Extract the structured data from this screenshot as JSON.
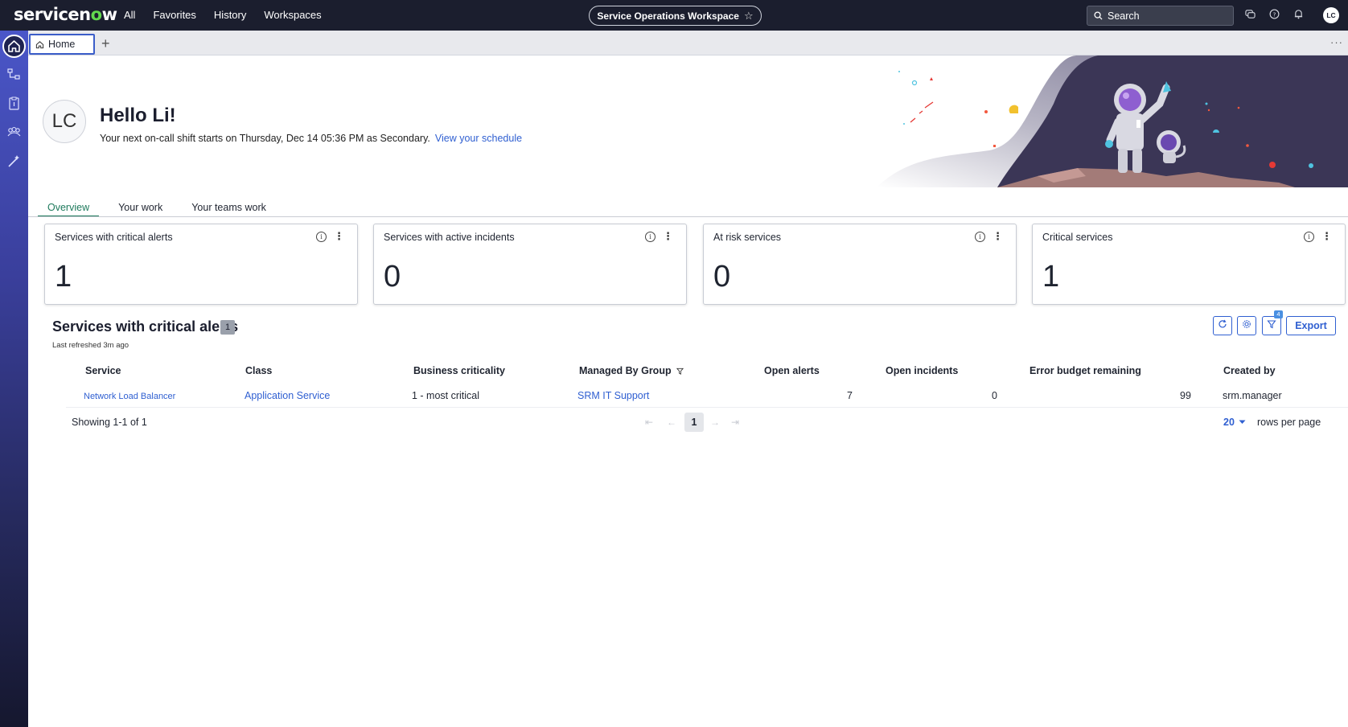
{
  "topbar": {
    "brand_prefix": "servicen",
    "brand_o": "o",
    "brand_suffix": "w",
    "nav": [
      "All",
      "Favorites",
      "History",
      "Workspaces"
    ],
    "workspace_label": "Service Operations Workspace",
    "search_placeholder": "Search",
    "user_initials": "LC"
  },
  "tabs": {
    "home_label": "Home",
    "add": "+",
    "more": "···"
  },
  "hero": {
    "avatar_initials": "LC",
    "greeting": "Hello Li!",
    "subtext": "Your next on-call shift starts on Thursday, Dec 14 05:36 PM as Secondary.",
    "schedule_link": "View your schedule"
  },
  "view_tabs": [
    "Overview",
    "Your work",
    "Your teams work"
  ],
  "cards": [
    {
      "title": "Services with critical alerts",
      "value": "1"
    },
    {
      "title": "Services with active incidents",
      "value": "0"
    },
    {
      "title": "At risk services",
      "value": "0"
    },
    {
      "title": "Critical services",
      "value": "1"
    }
  ],
  "list": {
    "title": "Services with critical alerts",
    "count": "1",
    "last_refreshed": "Last refreshed 3m ago",
    "filter_count": "4",
    "export_label": "Export",
    "columns": [
      "Service",
      "Class",
      "Business criticality",
      "Managed By Group",
      "Open alerts",
      "Open incidents",
      "Error budget remaining",
      "Created by"
    ],
    "rows": [
      {
        "service": "Network Load Balancer",
        "class": "Application Service",
        "criticality": "1 - most critical",
        "group": "SRM IT Support",
        "open_alerts": "7",
        "open_incidents": "0",
        "error_budget": "99",
        "created_by": "srm.manager"
      }
    ],
    "showing": "Showing 1-1 of 1",
    "current_page": "1",
    "rows_per_page": "20",
    "rows_per_page_label": "rows per page"
  },
  "colors": {
    "topbar_bg": "#1b1e2e",
    "accent_link": "#2f5fd1",
    "active_tab": "#1e7a5c",
    "brand_o": "#62d84e"
  }
}
